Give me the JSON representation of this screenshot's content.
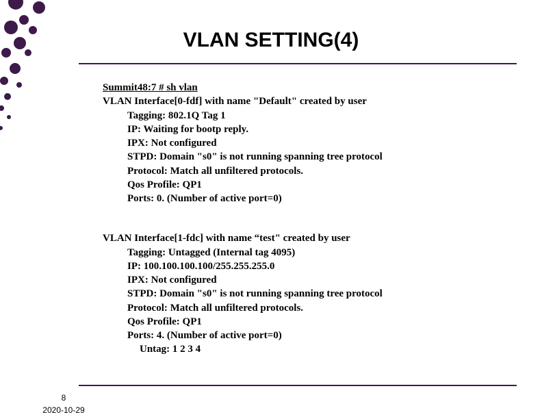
{
  "title": "VLAN SETTING(4)",
  "command": "Summit48:7 # sh vlan",
  "block1": {
    "header": "VLAN Interface[0-fdf] with name \"Default\" created by user",
    "tagging": "Tagging:   802.1Q Tag 1",
    "ip": "IP:           Waiting for bootp reply.",
    "ipx": "IPX:         Not configured",
    "stpd": "STPD:       Domain \"s0\" is not running spanning tree protocol",
    "proto": "Protocol:   Match all unfiltered protocols.",
    "qos": "Qos Profile:       QP1",
    "ports": "Ports:      0.       (Number of active port=0)"
  },
  "block2": {
    "header": "VLAN Interface[1-fdc] with name “test\" created by user",
    "tagging": "Tagging:    Untagged (Internal tag 4095)",
    "ip": "IP:           100.100.100.100/255.255.255.0",
    "ipx": "IPX:          Not configured",
    "stpd": "STPD:        Domain \"s0\" is not running spanning tree protocol",
    "proto": "Protocol:   Match all unfiltered protocols.",
    "qos": "Qos Profile:        QP1",
    "ports": "Ports:       4.      (Number of active port=0)",
    "untag": "Untag:  1 2 3 4"
  },
  "footer": {
    "page": "8",
    "date": "2020-10-29"
  },
  "colors": {
    "accent": "#3d1a4a"
  }
}
